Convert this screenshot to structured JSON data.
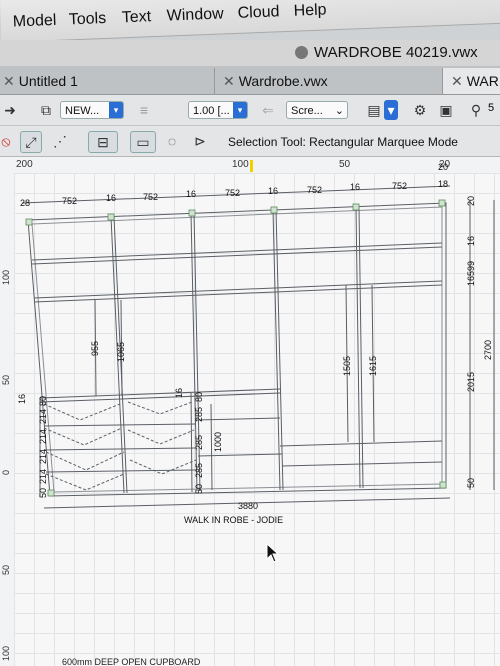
{
  "menu": {
    "items": [
      "Model",
      "Tools",
      "Text",
      "Window",
      "Cloud",
      "Help"
    ]
  },
  "window": {
    "title": "WARDROBE 40219.vwx"
  },
  "tabs": [
    {
      "label": "Untitled 1"
    },
    {
      "label": "Wardrobe.vwx"
    },
    {
      "label": "WAR"
    }
  ],
  "toolbar": {
    "class_select": "NEW...",
    "scale_select": "1.00 [...",
    "view_select": "Scre...",
    "zoom_value": "5"
  },
  "status": {
    "text": "Selection Tool: Rectangular Marquee Mode"
  },
  "rulers": {
    "top": [
      "200",
      "100",
      "50",
      "20"
    ],
    "left": [
      "100",
      "50",
      "0",
      "50",
      "100"
    ]
  },
  "drawing": {
    "title": "WALK IN ROBE - JODIE",
    "footer_note": "600mm DEEP OPEN CUPBOARD",
    "top_dims": [
      "28",
      "752",
      "16",
      "752",
      "16",
      "752",
      "16",
      "752",
      "16",
      "752",
      "18"
    ],
    "top_right_label": "20",
    "total_width": "3880",
    "total_height": "2700",
    "right_dims": [
      "20",
      "16",
      "599",
      "16",
      "2015",
      "50"
    ],
    "hang_dims": [
      "955",
      "1065",
      "1505",
      "1615"
    ],
    "left_stack": [
      "50",
      "214",
      "214",
      "214",
      "214",
      "80",
      "16"
    ],
    "mid_stack": [
      "50",
      "285",
      "285",
      "285",
      "80",
      "16"
    ],
    "mid_height": "1000"
  },
  "colors": {
    "accent": "#2a6dd4",
    "drawing_line": "#5a5f66"
  }
}
